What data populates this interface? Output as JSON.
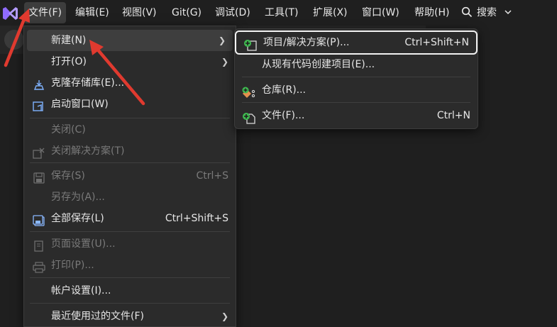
{
  "menubar": {
    "items": [
      "文件(F)",
      "编辑(E)",
      "视图(V)",
      "Git(G)",
      "调试(D)",
      "工具(T)",
      "扩展(X)",
      "窗口(W)",
      "帮助(H)"
    ],
    "search_label": "搜索"
  },
  "file_menu": {
    "items": [
      {
        "label": "新建(N)",
        "shortcut": "",
        "submenu": true,
        "icon": "none"
      },
      {
        "label": "打开(O)",
        "shortcut": "",
        "submenu": true,
        "icon": "none"
      },
      {
        "label": "克隆存储库(E)...",
        "shortcut": "",
        "icon": "clone-repo-icon"
      },
      {
        "label": "启动窗口(W)",
        "shortcut": "",
        "icon": "start-window-icon"
      },
      {
        "label": "关闭(C)",
        "shortcut": "",
        "disabled": true
      },
      {
        "label": "关闭解决方案(T)",
        "shortcut": "",
        "disabled": true,
        "icon": "close-solution-icon"
      },
      {
        "label": "保存(S)",
        "shortcut": "Ctrl+S",
        "disabled": true,
        "icon": "save-icon"
      },
      {
        "label": "另存为(A)...",
        "shortcut": "",
        "disabled": true
      },
      {
        "label": "全部保存(L)",
        "shortcut": "Ctrl+Shift+S",
        "icon": "save-all-icon"
      },
      {
        "label": "页面设置(U)...",
        "shortcut": "",
        "disabled": true,
        "icon": "page-setup-icon"
      },
      {
        "label": "打印(P)...",
        "shortcut": "",
        "disabled": true,
        "icon": "print-icon"
      },
      {
        "label": "帐户设置(I)...",
        "shortcut": ""
      },
      {
        "label": "最近使用过的文件(F)",
        "shortcut": "",
        "submenu": true
      }
    ]
  },
  "new_submenu": {
    "items": [
      {
        "label": "项目/解决方案(P)...",
        "shortcut": "Ctrl+Shift+N",
        "icon": "new-project-icon"
      },
      {
        "label": "从现有代码创建项目(E)...",
        "shortcut": ""
      },
      {
        "label": "仓库(R)...",
        "shortcut": "",
        "icon": "repository-icon"
      },
      {
        "label": "文件(F)...",
        "shortcut": "Ctrl+N",
        "icon": "new-file-icon"
      }
    ]
  },
  "colors": {
    "background": "#1f1f1f",
    "menu_bg": "#2b2b2b",
    "accent_purple": "#9b7bff",
    "annotation_red": "#e03a2f",
    "new_green": "#3fb950"
  }
}
